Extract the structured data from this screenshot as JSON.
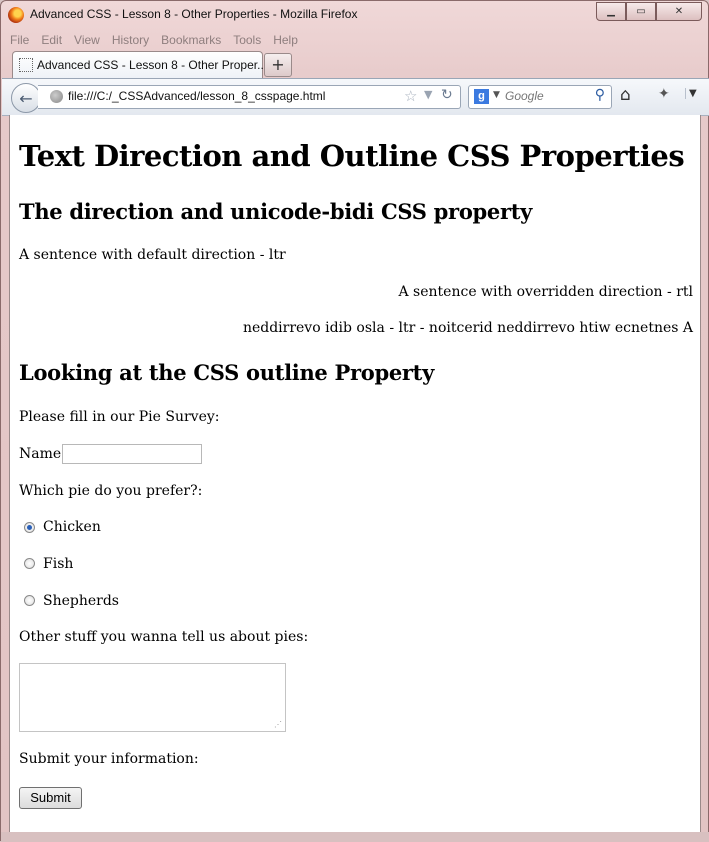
{
  "window": {
    "title": "Advanced CSS - Lesson 8 - Other Properties - Mozilla Firefox",
    "controls": {
      "minimize": "▁",
      "maximize": "▭",
      "close": "✕"
    }
  },
  "menu": [
    "File",
    "Edit",
    "View",
    "History",
    "Bookmarks",
    "Tools",
    "Help"
  ],
  "tab": {
    "label": "Advanced CSS - Lesson 8 - Other Proper...",
    "new_tab": "+"
  },
  "nav": {
    "url": "file:///C:/_CSSAdvanced/lesson_8_csspage.html",
    "search_placeholder": "Google",
    "search_engine_letter": "g"
  },
  "page": {
    "h1": "Text Direction and Outline CSS Properties",
    "h2_direction": "The direction and unicode-bidi CSS property",
    "ltr_sentence": "A sentence with default direction - ltr",
    "rtl_sentence": "A sentence with overridden direction - rtl",
    "bidi_sentence": "neddirrevo idib osla - ltr - noitcerid neddirrevo htiw ecnetnes A",
    "h2_outline": "Looking at the CSS outline Property",
    "survey_intro": "Please fill in our Pie Survey:",
    "name_label": "Name:",
    "name_value": "",
    "pie_question": "Which pie do you prefer?:",
    "pies": [
      {
        "label": "Chicken",
        "checked": true
      },
      {
        "label": "Fish",
        "checked": false
      },
      {
        "label": "Shepherds",
        "checked": false
      }
    ],
    "other_label": "Other stuff you wanna tell us about pies:",
    "other_value": "",
    "submit_label": "Submit your information:",
    "submit_button": "Submit"
  },
  "colors": {
    "accent": "#2a60b8",
    "titlebar": "#e6c9c9"
  }
}
